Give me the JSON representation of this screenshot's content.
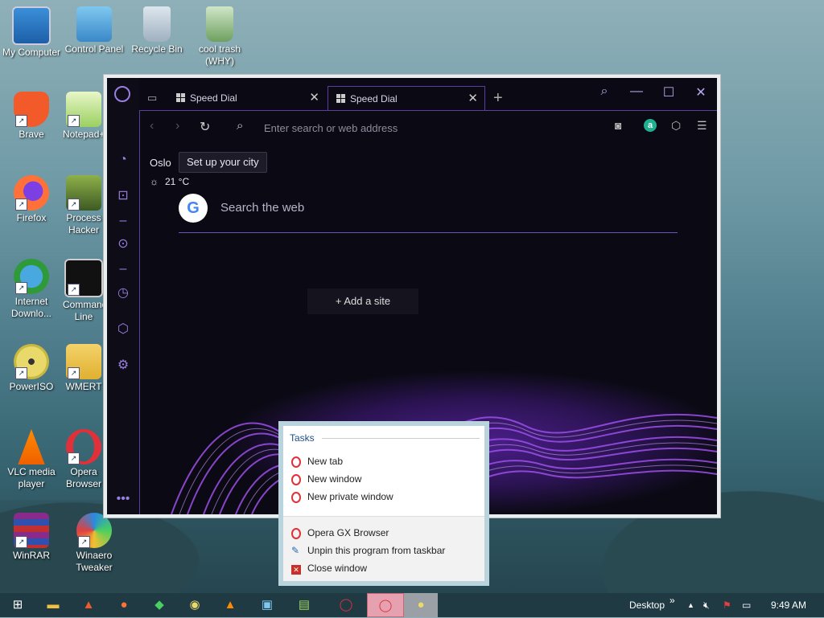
{
  "desktop": {
    "icons": [
      {
        "label": "My Computer"
      },
      {
        "label": "Control Panel"
      },
      {
        "label": "Recycle Bin"
      },
      {
        "label": "cool trash (WHY)"
      },
      {
        "label": "Brave"
      },
      {
        "label": "Notepad++"
      },
      {
        "label": "Firefox"
      },
      {
        "label": "Process Hacker"
      },
      {
        "label": "Internet Downlo..."
      },
      {
        "label": "Command Line"
      },
      {
        "label": "PowerISO"
      },
      {
        "label": "WMERT"
      },
      {
        "label": "VLC media player"
      },
      {
        "label": "Opera Browser"
      },
      {
        "label": "WinRAR"
      },
      {
        "label": "Winaero Tweaker"
      }
    ]
  },
  "browser": {
    "tabs": [
      {
        "label": "Speed Dial"
      },
      {
        "label": "Speed Dial"
      }
    ],
    "new_tab_symbol": "+",
    "address_placeholder": "Enter search or web address",
    "weather": {
      "city": "Oslo",
      "setup_label": "Set up your city",
      "temp": "21 °C"
    },
    "search_label": "Search the web",
    "google_glyph": "G",
    "add_site_label": "+ Add a site"
  },
  "jumplist": {
    "section_title": "Tasks",
    "tasks": [
      {
        "label": "New tab"
      },
      {
        "label": "New window"
      },
      {
        "label": "New private window"
      }
    ],
    "pinned": [
      {
        "label": "Opera GX Browser"
      },
      {
        "label": "Unpin this program from taskbar"
      },
      {
        "label": "Close window"
      }
    ]
  },
  "taskbar": {
    "desktop_label": "Desktop",
    "time": "9:49 AM"
  },
  "colors": {
    "accent": "#5a3fa0",
    "opera_red": "#e0303a",
    "taskbar": "#203a44"
  }
}
